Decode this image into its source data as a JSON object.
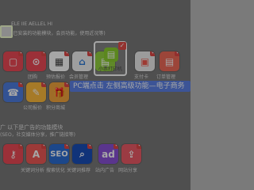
{
  "colors": {
    "tab_border": "#f3ffd0",
    "callout_bg": "#5c82e6",
    "check_red": "#e04845"
  },
  "left_tab": "",
  "top_lines": {
    "line1": "ELE IIE AELLEL HI",
    "line2": "(已安装的功能模块，会员功能，使用近况等)"
  },
  "row1": [
    {
      "label": "",
      "icon": "page-icon"
    },
    {
      "label": "团购",
      "icon": "t-icon"
    },
    {
      "label": "预估报价",
      "icon": "calc-icon"
    },
    {
      "label": "会员管理",
      "icon": "store-icon"
    },
    {
      "label": "",
      "icon": "print-icon"
    },
    {
      "label": "支付卡",
      "icon": "card-icon"
    },
    {
      "label": "订单管理",
      "icon": "order-icon"
    }
  ],
  "row2": [
    {
      "label": "",
      "icon": "phone-icon"
    },
    {
      "label": "公司报价",
      "icon": "tag-icon"
    },
    {
      "label": "积分商城",
      "icon": "gift-icon"
    }
  ],
  "highlight": {
    "label": "小票打印机",
    "icon": "printer-icon"
  },
  "callout": "PC端点击 左侧高级功能—电子商务",
  "section2": {
    "line1": "广  以下是广告的功能模块",
    "line2": "(SEO，社交媒体分享，推广链接等)"
  },
  "row3": [
    {
      "label": "关键词分析",
      "icon": "key-icon"
    },
    {
      "label": "搜索优化",
      "icon": "seo-icon"
    },
    {
      "label": "关键词推荐",
      "icon": "mag-icon"
    },
    {
      "label": "站内广告",
      "icon": "ad-icon"
    },
    {
      "label": "网站分享",
      "icon": "share-icon"
    }
  ]
}
